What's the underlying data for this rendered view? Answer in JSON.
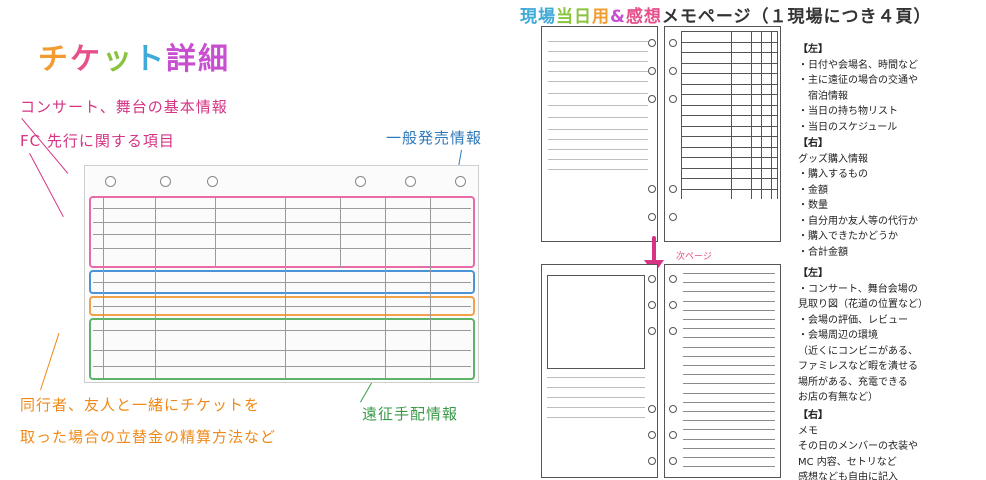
{
  "left": {
    "title_chars": [
      "チ",
      "ケ",
      "ッ",
      "ト",
      "詳細"
    ],
    "callouts": {
      "basic_info": "コンサート、舞台の基本情報",
      "fc_presale": "FC 先行に関する項目",
      "general_sale": "一般発売情報",
      "companion_line1": "同行者、友人と一緒にチケットを",
      "companion_line2": "取った場合の立替金の精算方法など",
      "trip_info": "遠征手配情報"
    },
    "colors": {
      "pink": "#e86aa7",
      "blue": "#4c93d6",
      "orange": "#f2a24b",
      "green": "#5db36a"
    }
  },
  "right": {
    "title_parts": [
      "現場",
      "当日",
      "用",
      "&",
      "感想",
      "メモページ（１現場につき４頁）"
    ],
    "next_page_label": "次ページ",
    "notes": [
      {
        "heading": "【左】",
        "lines": [
          "・日付や会場名、時間など",
          "・主に遠征の場合の交通や",
          "　宿泊情報",
          "・当日の持ち物リスト",
          "・当日のスケジュール"
        ]
      },
      {
        "heading": "【右】",
        "lines": [
          "グッズ購入情報",
          "・購入するもの",
          "・金額",
          "・数量",
          "・自分用か友人等の代行か",
          "・購入できたかどうか",
          "・合計金額"
        ]
      },
      {
        "heading": "【左】",
        "lines": [
          "・コンサート、舞台会場の",
          "見取り図（花道の位置など）",
          "・会場の評価、レビュー",
          "・会場周辺の環境",
          "（近くにコンビニがある、",
          "ファミレスなど暇を潰せる",
          "場所がある、充電できる",
          "お店の有無など）"
        ]
      },
      {
        "heading": "【右】",
        "lines": [
          "メモ",
          "その日のメンバーの衣装や",
          "MC 内容、セトリなど",
          "感想なども自由に記入"
        ]
      }
    ]
  }
}
